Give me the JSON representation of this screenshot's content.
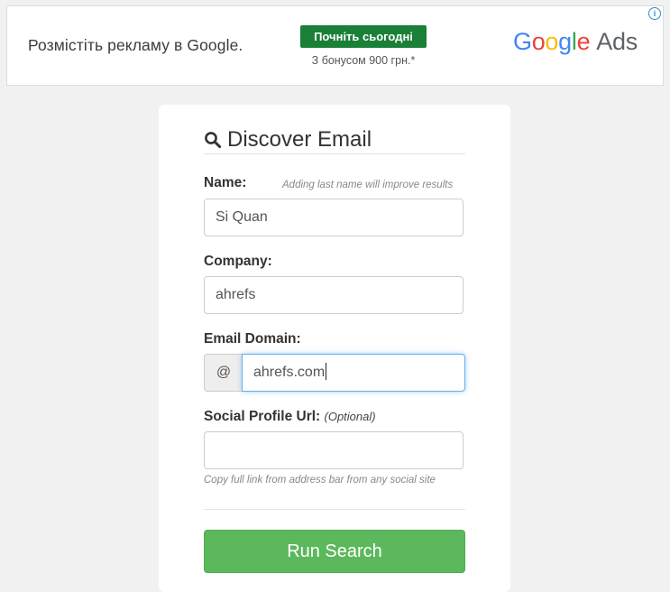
{
  "ad": {
    "headline": "Розмістіть рекламу в Google.",
    "cta": "Почніть сьогодні",
    "bonus": "З бонусом 900 грн.*",
    "brand_letters": [
      "G",
      "o",
      "o",
      "g",
      "l",
      "e"
    ],
    "brand_product": "Ads",
    "info_glyph": "i",
    "colors": {
      "cta_bg": "#1a7f37",
      "g_blue": "#4285f4",
      "g_red": "#ea4335",
      "g_yellow": "#fbbc05",
      "g_green": "#34a853"
    }
  },
  "form": {
    "title": "Discover Email",
    "title_icon": "search-icon",
    "name": {
      "label": "Name:",
      "hint": "Adding last name will improve results",
      "value": "Si Quan"
    },
    "company": {
      "label": "Company:",
      "value": "ahrefs"
    },
    "email_domain": {
      "label": "Email Domain:",
      "addon": "@",
      "value": "ahrefs.com"
    },
    "social": {
      "label": "Social Profile Url:",
      "optional": "(Optional)",
      "value": "",
      "hint": "Copy full link from address bar from any social site"
    },
    "submit_label": "Run Search",
    "colors": {
      "submit_bg": "#5cb85c",
      "focus_border": "#66afe9"
    }
  }
}
